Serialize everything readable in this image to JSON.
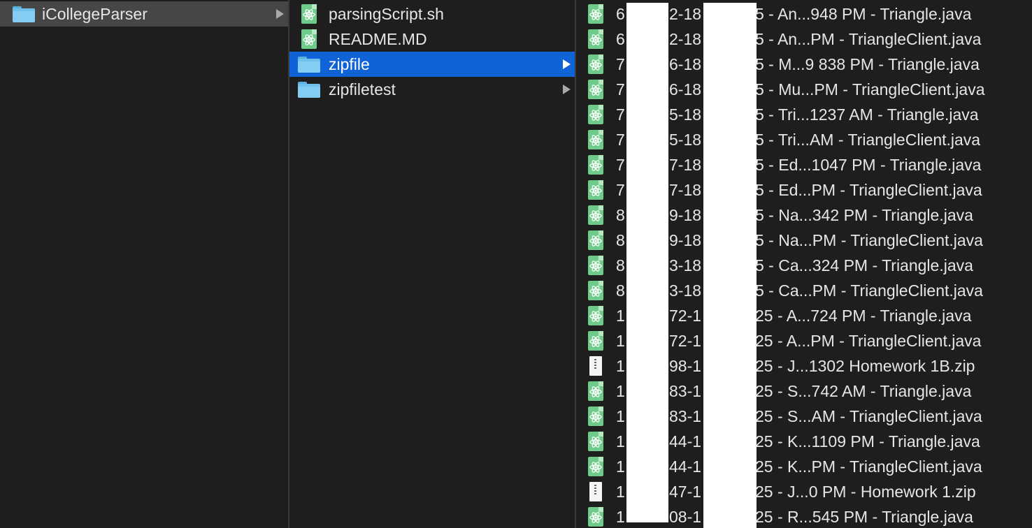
{
  "column1": {
    "items": [
      {
        "name": "iCollegeParser",
        "type": "folder",
        "selected": "gray"
      }
    ]
  },
  "column2": {
    "items": [
      {
        "name": "parsingScript.sh",
        "type": "file"
      },
      {
        "name": "README.MD",
        "type": "file"
      },
      {
        "name": "zipfile",
        "type": "folder",
        "selected": "blue"
      },
      {
        "name": "zipfiletest",
        "type": "folder"
      }
    ]
  },
  "column3": {
    "items": [
      {
        "prefix": "6",
        "middle": "2-18",
        "suffix": "5 - An...948 PM - Triangle.java",
        "type": "file"
      },
      {
        "prefix": "6",
        "middle": "2-18",
        "suffix": "5 - An...PM - TriangleClient.java",
        "type": "file"
      },
      {
        "prefix": "7",
        "middle": "6-18",
        "suffix": "5 - M...9 838 PM - Triangle.java",
        "type": "file"
      },
      {
        "prefix": "7",
        "middle": "6-18",
        "suffix": "5 - Mu...PM - TriangleClient.java",
        "type": "file"
      },
      {
        "prefix": "7",
        "middle": "5-18",
        "suffix": "5 - Tri...1237 AM - Triangle.java",
        "type": "file"
      },
      {
        "prefix": "7",
        "middle": "5-18",
        "suffix": "5 - Tri...AM - TriangleClient.java",
        "type": "file"
      },
      {
        "prefix": "7",
        "middle": "7-18",
        "suffix": "5 - Ed...1047 PM - Triangle.java",
        "type": "file"
      },
      {
        "prefix": "7",
        "middle": "7-18",
        "suffix": "5 - Ed...PM - TriangleClient.java",
        "type": "file"
      },
      {
        "prefix": "8",
        "middle": "9-18",
        "suffix": "5 - Na...342 PM - Triangle.java",
        "type": "file"
      },
      {
        "prefix": "8",
        "middle": "9-18",
        "suffix": "5 - Na...PM - TriangleClient.java",
        "type": "file"
      },
      {
        "prefix": "8",
        "middle": "3-18",
        "suffix": "5 - Ca...324 PM - Triangle.java",
        "type": "file"
      },
      {
        "prefix": "8",
        "middle": "3-18",
        "suffix": "5 - Ca...PM - TriangleClient.java",
        "type": "file"
      },
      {
        "prefix": "1",
        "middle": "72-1",
        "suffix": "25 - A...724 PM - Triangle.java",
        "type": "file"
      },
      {
        "prefix": "1",
        "middle": "72-1",
        "suffix": "25 - A...PM - TriangleClient.java",
        "type": "file"
      },
      {
        "prefix": "1",
        "middle": "98-1",
        "suffix": "25 - J...1302 Homework 1B.zip",
        "type": "zip"
      },
      {
        "prefix": "1",
        "middle": "83-1",
        "suffix": "25 - S...742 AM - Triangle.java",
        "type": "file"
      },
      {
        "prefix": "1",
        "middle": "83-1",
        "suffix": "25 - S...AM - TriangleClient.java",
        "type": "file"
      },
      {
        "prefix": "1",
        "middle": "44-1",
        "suffix": "25 - K...1109 PM - Triangle.java",
        "type": "file"
      },
      {
        "prefix": "1",
        "middle": "44-1",
        "suffix": "25 - K...PM - TriangleClient.java",
        "type": "file"
      },
      {
        "prefix": "1",
        "middle": "47-1",
        "suffix": "25 - J...0 PM - Homework 1.zip",
        "type": "zip"
      },
      {
        "prefix": "1",
        "middle": "08-1",
        "suffix": "25 - R...545 PM - Triangle.java",
        "type": "file"
      }
    ]
  },
  "colors": {
    "background": "#1e1e1e",
    "selected_active": "#0f63d6",
    "selected_inactive": "#464646",
    "folder": "#6fc0ea",
    "atom_file": "#6ecb8a"
  },
  "icons": {
    "folder": "folder-icon",
    "file": "atom-file-icon",
    "zip": "zip-archive-icon"
  }
}
